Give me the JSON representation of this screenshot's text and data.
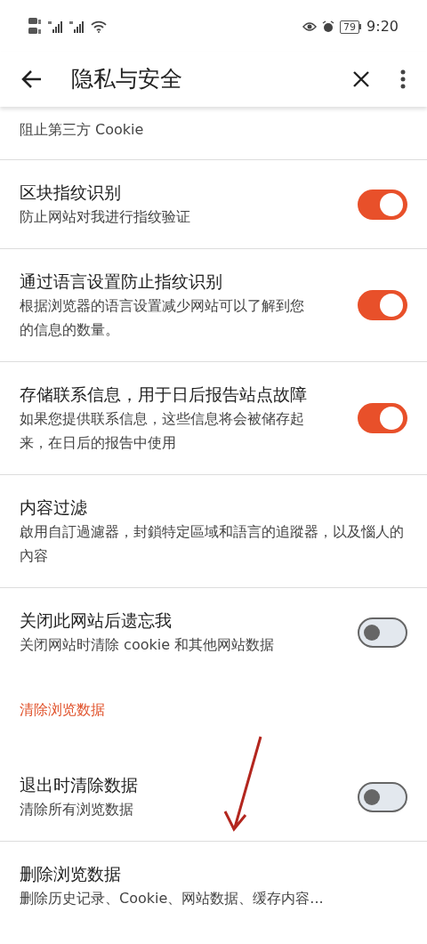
{
  "status_bar": {
    "battery": "79",
    "time": "9:20"
  },
  "app_bar": {
    "title": "隐私与安全"
  },
  "items": [
    {
      "kind": "setting",
      "subtitle": "阻止第三方 Cookie"
    },
    {
      "kind": "toggle",
      "title": "区块指纹识别",
      "subtitle": "防止网站对我进行指纹验证",
      "on": true
    },
    {
      "kind": "toggle",
      "title": "通过语言设置防止指纹识别",
      "subtitle": "根据浏览器的语言设置减少网站可以了解到您的信息的数量。",
      "on": true
    },
    {
      "kind": "toggle",
      "title": "存储联系信息，用于日后报告站点故障",
      "subtitle": "如果您提供联系信息，这些信息将会被储存起来，在日后的报告中使用",
      "on": true
    },
    {
      "kind": "setting",
      "title": "内容过滤",
      "subtitle": "啟用自訂過濾器，封鎖特定區域和語言的追蹤器，以及惱人的內容"
    },
    {
      "kind": "toggle",
      "title": "关闭此网站后遗忘我",
      "subtitle": "关闭网站时清除 cookie 和其他网站数据",
      "on": false
    },
    {
      "kind": "header",
      "title": "清除浏览数据"
    },
    {
      "kind": "toggle",
      "title": "退出时清除数据",
      "subtitle": "清除所有浏览数据",
      "on": false
    },
    {
      "kind": "setting",
      "title": "删除浏览数据",
      "subtitle": "删除历史记录、Cookie、网站数据、缓存内容..."
    }
  ]
}
